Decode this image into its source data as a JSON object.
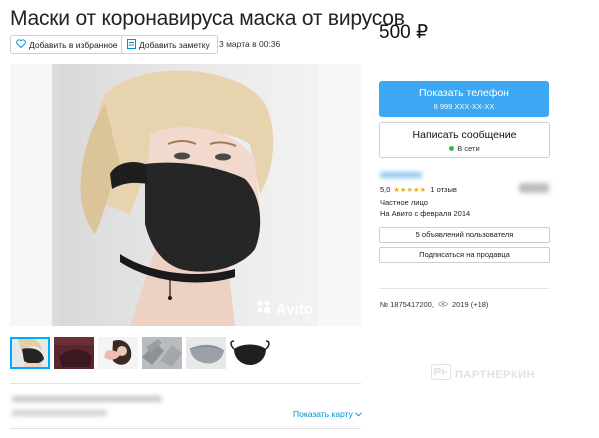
{
  "listing": {
    "title": "Маски от коронавируса маска от вирусов",
    "favorite_label": "Добавить в избранное",
    "note_label": "Добавить заметку",
    "date": "3 марта в 00:36",
    "price": "500 ₽",
    "watermark": "Avito"
  },
  "contact": {
    "phone_button": "Показать телефон",
    "phone_number": "8 999 XXX-XX-XX",
    "message_button": "Написать сообщение",
    "online_status": "В сети"
  },
  "seller": {
    "rating": "5,0",
    "stars": "★★★★★",
    "reviews": "1 отзыв",
    "type": "Частное лицо",
    "since": "На Авито с февраля 2014",
    "ads_button": "5 объявлений пользователя",
    "subscribe_button": "Подписаться на продавца"
  },
  "stats": {
    "ad_number": "№ 1875417200,",
    "views": "2019 (+18)"
  },
  "map": {
    "show_map": "Показать карту"
  },
  "partner": {
    "label": "ПАРТНЕРКИН"
  },
  "colors": {
    "accent": "#3ca7f2",
    "link": "#0091d9",
    "online": "#3bb54a",
    "star": "#ffa800"
  },
  "icons": [
    "heart-icon",
    "note-icon",
    "eye-icon",
    "chevron-down-icon",
    "paw-icon"
  ]
}
